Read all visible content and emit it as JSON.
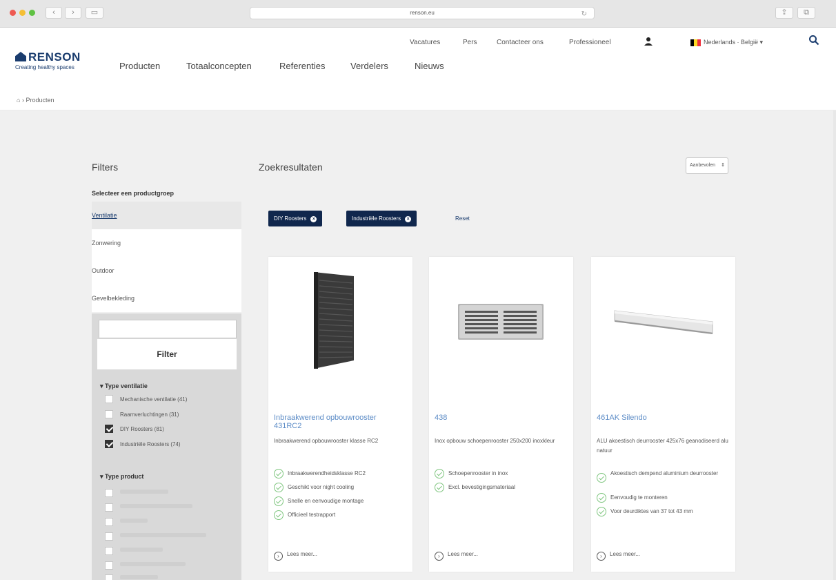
{
  "browser": {
    "url": "renson.eu"
  },
  "header": {
    "util_links": [
      "Vacatures",
      "Pers",
      "Contacteer ons",
      "Professioneel"
    ],
    "language": "Nederlands · België",
    "logo_text": "RENSON",
    "logo_sub": "Creating healthy spaces",
    "nav": [
      "Producten",
      "Totaalconcepten",
      "Referenties",
      "Verdelers",
      "Nieuws"
    ],
    "breadcrumb": "Producten"
  },
  "filters": {
    "title": "Filters",
    "group_label": "Selecteer een productgroep",
    "categories": [
      "Ventilatie",
      "Zonwering",
      "Outdoor",
      "Gevelbekleding"
    ],
    "search_placeholder": "",
    "filter_button": "Filter",
    "facet1_title": "Type ventilatie",
    "facet1_items": [
      {
        "label": "Mechanische ventilatie (41)",
        "checked": false
      },
      {
        "label": "Raamverluchtingen (31)",
        "checked": false
      },
      {
        "label": "DIY Roosters (81)",
        "checked": true
      },
      {
        "label": "Industriële Roosters (74)",
        "checked": true
      }
    ],
    "facet2_title": "Type product"
  },
  "results": {
    "title": "Zoekresultaten",
    "sort_label": "Aanbevolen",
    "chips": [
      "DIY Roosters",
      "Industriële Roosters"
    ],
    "reset": "Reset",
    "read_more": "Lees meer...",
    "cards": [
      {
        "title": "Inbraakwerend opbouwrooster 431RC2",
        "desc": "Inbraakwerend opbouwrooster klasse RC2",
        "features": [
          "Inbraakwerendheidsklasse RC2",
          "Geschikt voor night cooling",
          "Snelle en eenvoudige montage",
          "Officieel testrapport"
        ]
      },
      {
        "title": "438",
        "desc": "Inox opbouw schoepenrooster 250x200 inoxkleur",
        "features": [
          "Schoepenrooster in inox",
          "Excl. bevestigingsmateriaal"
        ]
      },
      {
        "title": "461AK Silendo",
        "desc": "ALU akoestisch deurrooster 425x76 geanodiseerd alu natuur",
        "features": [
          "Akoestisch dempend aluminium deurrooster",
          "Eenvoudig te monteren",
          "Voor deurdiktes van 37 tot 43 mm"
        ]
      }
    ]
  }
}
